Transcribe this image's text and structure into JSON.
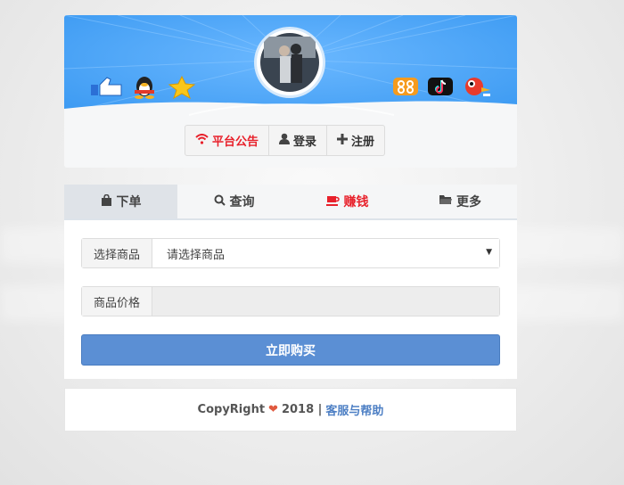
{
  "header": {
    "left_icons": [
      "thumbs-up-icon",
      "qq-penguin-icon",
      "star-icon"
    ],
    "right_icons": [
      "app-logo-icon",
      "tiktok-icon",
      "bird-icon"
    ],
    "buttons": [
      {
        "label": "平台公告",
        "icon": "wifi-icon"
      },
      {
        "label": "登录",
        "icon": "user-icon"
      },
      {
        "label": "注册",
        "icon": "plus-icon"
      }
    ]
  },
  "tabs": [
    {
      "label": "下单",
      "icon": "bag-icon"
    },
    {
      "label": "查询",
      "icon": "search-icon"
    },
    {
      "label": "赚钱",
      "icon": "coffee-icon"
    },
    {
      "label": "更多",
      "icon": "folder-icon"
    }
  ],
  "form": {
    "product_label": "选择商品",
    "product_value": "请选择商品",
    "price_label": "商品价格",
    "price_value": "",
    "buy_label": "立即购买"
  },
  "footer": {
    "copyright": "CopyRight",
    "year": "2018 |",
    "help_link": "客服与帮助"
  },
  "colors": {
    "banner_blue": "#45a3f7",
    "accent_red": "#e8212b",
    "button_blue": "#5b8fd4",
    "link_blue": "#4d7fc4"
  }
}
